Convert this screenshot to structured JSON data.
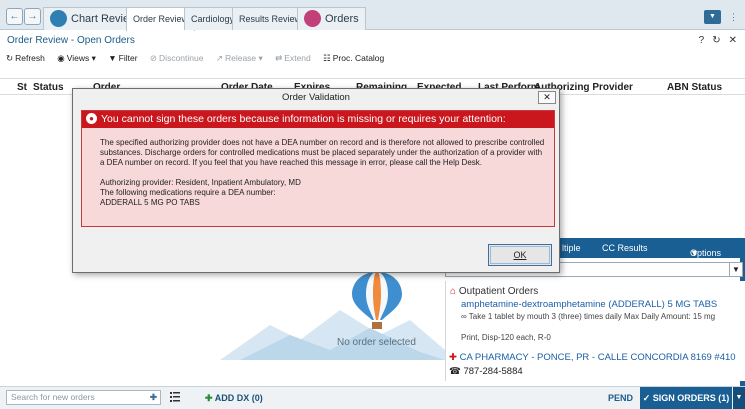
{
  "nav": {
    "tabs": [
      {
        "label": "Chart Review"
      },
      {
        "label": "Order Review"
      },
      {
        "label": "Cardiology"
      },
      {
        "label": "Results Review"
      },
      {
        "label": "Orders"
      }
    ]
  },
  "page": {
    "title": "Order Review - Open Orders"
  },
  "toolbar": {
    "refresh": "Refresh",
    "views": "Views",
    "filter": "Filter",
    "discontinue": "Discontinue",
    "release": "Release",
    "extend": "Extend",
    "proc_catalog": "Proc. Catalog"
  },
  "columns": [
    "St",
    "Status",
    "Order",
    "Order Date",
    "Expires",
    "Remaining",
    "Expected",
    "Last Perform",
    "Authorizing Provider",
    "ABN Status"
  ],
  "empty_state": "No order selected",
  "right_panel": {
    "header": {
      "multiple": "ltiple",
      "cc_results": "CC Results",
      "options": "Options"
    },
    "section_title": "Outpatient Orders",
    "medication": "amphetamine-dextroamphetamine (ADDERALL) 5 MG TABS",
    "sig": "Take 1 tablet by mouth 3 (three) times daily   Max Daily Amount: 15 mg",
    "print": "Print, Disp-120 each, R-0",
    "pharmacy": "CA PHARMACY - PONCE, PR - CALLE CONCORDIA 8169 #410",
    "phone": "787-284-5884"
  },
  "bottom": {
    "search_placeholder": "Search for new orders",
    "add_dx": "ADD DX (0)",
    "pend": "PEND",
    "sign": "SIGN ORDERS (1)"
  },
  "modal": {
    "title": "Order Validation",
    "alert_header": "You cannot sign these orders because information is missing or requires your attention:",
    "paragraph1": "The specified authorizing provider does not have a DEA number on record and is therefore not allowed to prescribe controlled substances.  Discharge orders for controlled medications must be placed separately under the authorization of a provider with a DEA number on record.  If you feel that you have reached this message in error, please call the Help Desk.",
    "provider_line": "Authorizing provider: Resident, Inpatient Ambulatory, MD",
    "meds_line": "The following medications require a DEA number:",
    "med_item": "ADDERALL 5 MG PO TABS",
    "ok_label": "OK"
  },
  "colors": {
    "accent": "#1a5f93",
    "alert_red": "#c9171d",
    "alert_bg": "#f8d9d9"
  }
}
